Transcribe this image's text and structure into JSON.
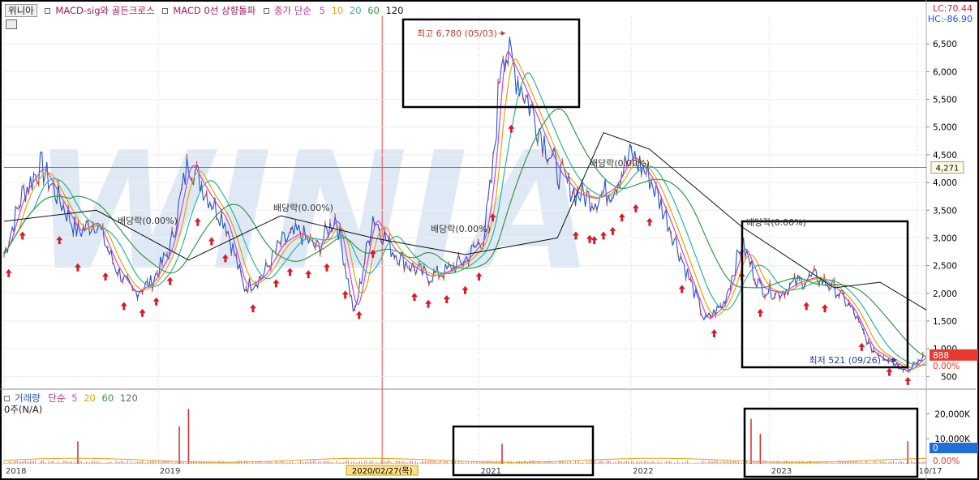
{
  "header": {
    "stock_name": "위니아",
    "indicators": [
      "MACD-sig와 골든크로스",
      "MACD 0선 상향돌파"
    ],
    "price_ma_label": "종가 단순",
    "price_ma_periods": [
      "5",
      "10",
      "20",
      "60",
      "120"
    ],
    "lc": "LC:70.44",
    "hc": "HC:-86.90"
  },
  "volume_legend": {
    "label": "거래량",
    "ma_label": "단순",
    "periods": [
      "5",
      "20",
      "60",
      "120"
    ],
    "subtitle": "0주(N/A)"
  },
  "colors": {
    "candle": "#2255cc",
    "ma5": "#cc44cc",
    "ma10": "#e0a400",
    "ma20": "#2bb3a0",
    "ma60": "#339944",
    "ma120": "#111111",
    "signal_arrow": "#d81b2b",
    "box": "#000000",
    "crosshair": "#ff4444",
    "watermark": "#dbe7f4"
  },
  "watermark": "WINIA",
  "chart_data": [
    {
      "type": "line",
      "x_ticks": [
        "2018",
        "2019",
        "2021",
        "2022",
        "2023",
        "10/17"
      ],
      "crosshair_date": "2020/02/27(목)",
      "crosshair_price_tag": "4,271",
      "current_price_tag": "888",
      "current_pct_tag": "0.00%",
      "ylim": [
        300,
        7000
      ],
      "y_ticks": [
        500,
        1000,
        1500,
        2000,
        2500,
        3000,
        3500,
        4000,
        4500,
        5000,
        5500,
        6000,
        6500
      ],
      "y_tick_labels": [
        "500",
        "1,000",
        "1,500",
        "2,000",
        "2,500",
        "3,000",
        "3,500",
        "4,000",
        "4,500",
        "5,000",
        "5,500",
        "6,000",
        "6,500"
      ],
      "annotations": {
        "high": "최고 6,780 (05/03)",
        "low": "최저 521 (09/26)",
        "dividend": [
          "배당락(0.00%)",
          "배당락(0.00%)",
          "배당락(0.00%)",
          "배당락(0.00%)",
          "배당락(0.00%)"
        ]
      },
      "series": [
        {
          "name": "종가",
          "x": [
            0,
            0.02,
            0.04,
            0.06,
            0.08,
            0.1,
            0.12,
            0.14,
            0.16,
            0.18,
            0.2,
            0.22,
            0.24,
            0.26,
            0.28,
            0.3,
            0.32,
            0.34,
            0.36,
            0.38,
            0.4,
            0.42,
            0.44,
            0.46,
            0.48,
            0.5,
            0.52,
            0.53,
            0.54,
            0.56,
            0.58,
            0.6,
            0.62,
            0.64,
            0.66,
            0.68,
            0.7,
            0.72,
            0.74,
            0.76,
            0.78,
            0.8,
            0.82,
            0.84,
            0.86,
            0.88,
            0.9,
            0.92,
            0.94,
            0.96,
            0.98,
            1.0
          ],
          "values": [
            2700,
            3800,
            4300,
            3700,
            3100,
            3300,
            2500,
            2000,
            2200,
            2800,
            4400,
            3800,
            3300,
            2100,
            2300,
            2900,
            3100,
            2800,
            3400,
            1600,
            3400,
            2800,
            2500,
            2300,
            2400,
            2600,
            3000,
            4200,
            6500,
            5800,
            5000,
            4200,
            3800,
            3700,
            3900,
            4500,
            4100,
            3300,
            2400,
            1500,
            1800,
            2900,
            2100,
            2000,
            2200,
            2300,
            2100,
            1700,
            1000,
            800,
            600,
            888
          ]
        },
        {
          "name": "120",
          "x": [
            0,
            0.1,
            0.2,
            0.3,
            0.4,
            0.5,
            0.6,
            0.65,
            0.7,
            0.8,
            0.9,
            0.95,
            1.0
          ],
          "values": [
            3300,
            3500,
            2600,
            3400,
            3000,
            2700,
            3000,
            4900,
            4600,
            3200,
            2100,
            2200,
            1700
          ]
        }
      ]
    },
    {
      "type": "bar",
      "title": "거래량",
      "ylim": [
        0,
        25000
      ],
      "y_tick_labels": [
        "20,000K",
        "10,000K",
        "0"
      ],
      "value_tag": "0",
      "pct_tag": "0.00%",
      "spikes": [
        {
          "x": 0.08,
          "value": 9000
        },
        {
          "x": 0.19,
          "value": 15000
        },
        {
          "x": 0.2,
          "value": 22000
        },
        {
          "x": 0.54,
          "value": 8000
        },
        {
          "x": 0.81,
          "value": 18000
        },
        {
          "x": 0.82,
          "value": 12000
        },
        {
          "x": 0.98,
          "value": 9000
        }
      ]
    }
  ]
}
